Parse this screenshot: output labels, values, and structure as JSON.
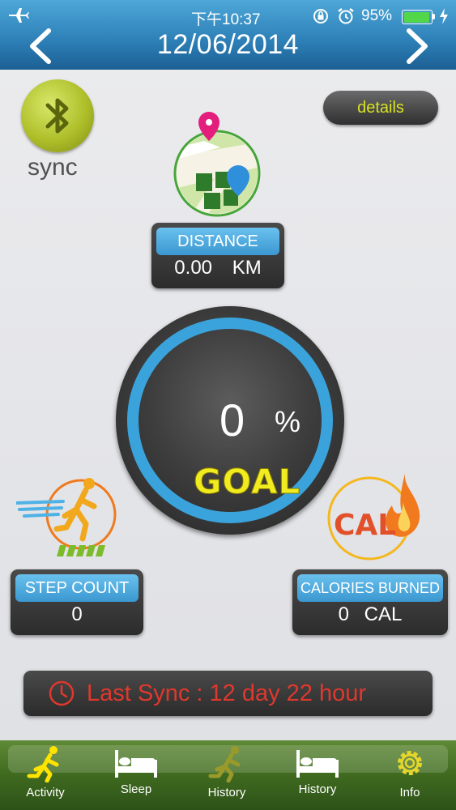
{
  "status_bar": {
    "time": "下午10:37",
    "battery_percent": "95%",
    "battery_level": 0.95
  },
  "header": {
    "date": "12/06/2014"
  },
  "sync": {
    "label": "sync"
  },
  "details": {
    "label": "details"
  },
  "distance": {
    "header": "DISTANCE",
    "value": "0.00",
    "unit": "KM"
  },
  "goal": {
    "value": "0",
    "unit": "%",
    "label": "GOAL",
    "progress": 0
  },
  "steps": {
    "header": "STEP COUNT",
    "value": "0"
  },
  "calories": {
    "header": "CALORIES BURNED",
    "value": "0",
    "unit": "CAL",
    "badge": "CAL"
  },
  "last_sync": {
    "text": "Last Sync :  12 day 22 hour"
  },
  "tabs": [
    {
      "label": "Activity",
      "icon": "runner-icon",
      "active": true
    },
    {
      "label": "Sleep",
      "icon": "bed-icon",
      "active": false
    },
    {
      "label": "History",
      "icon": "runner-icon",
      "active": false
    },
    {
      "label": "History",
      "icon": "bed-icon",
      "active": false
    },
    {
      "label": "Info",
      "icon": "gear-icon",
      "active": false
    }
  ],
  "colors": {
    "header_blue": "#2c7fb6",
    "accent_blue": "#3aa3dc",
    "goal_yellow": "#f1ec1f",
    "sync_red": "#e0382d",
    "tabbar_green": "#3f6a1f",
    "bluetooth_green": "#aebf2a"
  }
}
